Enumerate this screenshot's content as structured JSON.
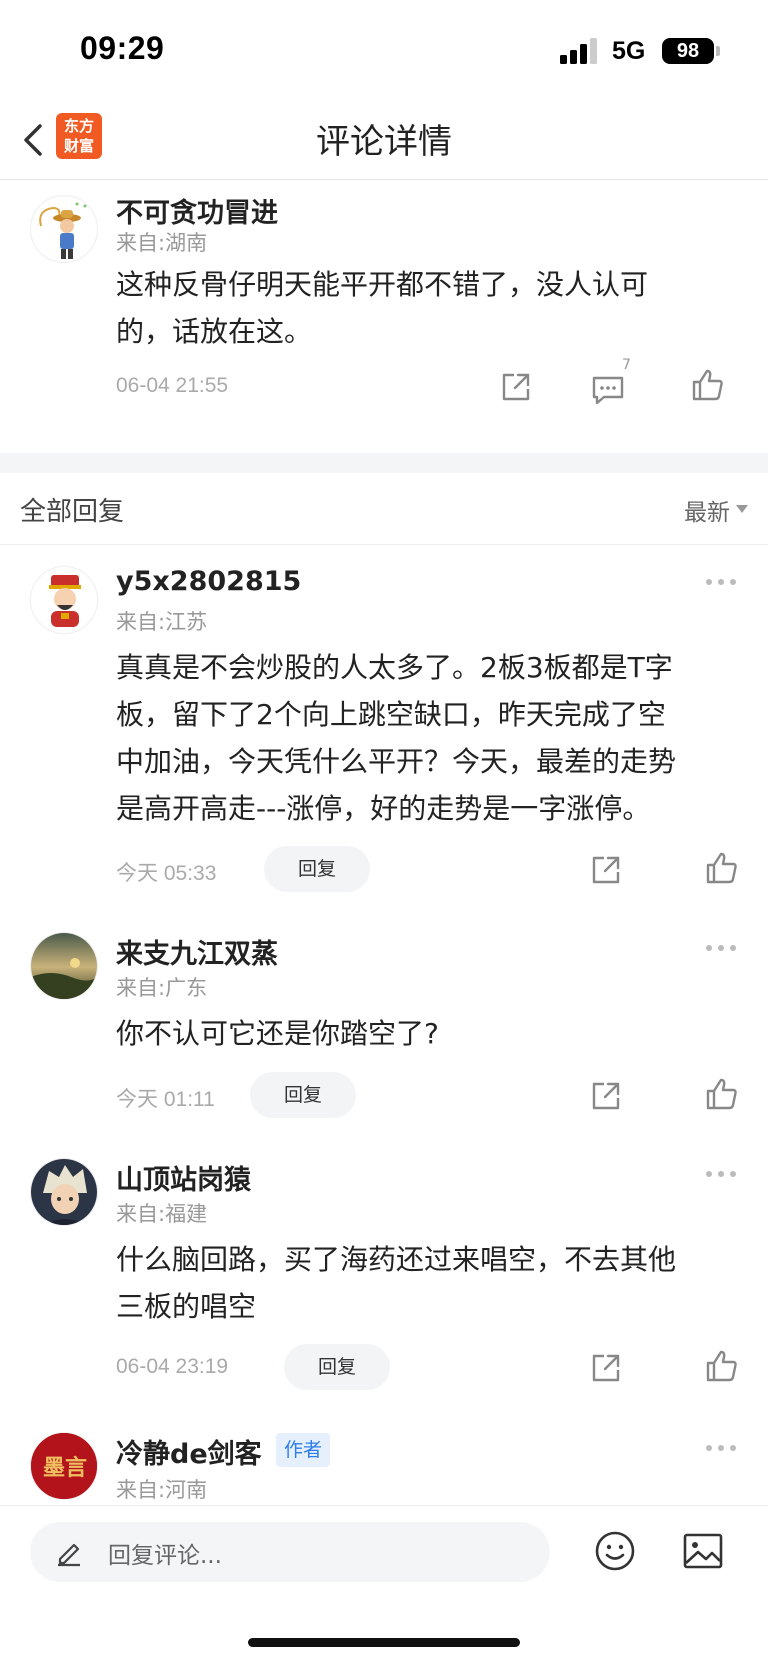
{
  "status": {
    "time": "09:29",
    "network": "5G",
    "battery": "98"
  },
  "header": {
    "logo_line1": "东方",
    "logo_line2": "财富",
    "title": "评论详情"
  },
  "main_comment": {
    "name": "不可贪功冒进",
    "location": "来自:湖南",
    "content_line1": "这种反骨仔明天能平开都不错了，没人认可",
    "content_line2": "的，话放在这。",
    "timestamp": "06-04 21:55",
    "reply_count": "7"
  },
  "replies_header": {
    "label": "全部回复",
    "sort": "最新"
  },
  "replies": [
    {
      "name": "y5x2802815",
      "location": "来自:江苏",
      "lines": [
        "真真是不会炒股的人太多了。2板3板都是T字",
        "板，留下了2个向上跳空缺口，昨天完成了空",
        "中加油，今天凭什么平开？今天，最差的走势",
        "是高开高走---涨停，好的走势是一字涨停。"
      ],
      "timestamp": "今天 05:33",
      "reply_label": "回复"
    },
    {
      "name": "来支九江双蒸",
      "location": "来自:广东",
      "lines": [
        "你不认可它还是你踏空了?"
      ],
      "timestamp": "今天 01:11",
      "reply_label": "回复"
    },
    {
      "name": "山顶站岗猿",
      "location": "来自:福建",
      "lines": [
        "什么脑回路，买了海药还过来唱空，不去其他",
        "三板的唱空"
      ],
      "timestamp": "06-04 23:19",
      "reply_label": "回复"
    },
    {
      "name": "冷静de剑客",
      "badge": "作者",
      "location": "来自:河南",
      "avatar_text": "墨言"
    }
  ],
  "input": {
    "placeholder": "回复评论..."
  },
  "colors": {
    "brand": "#f15a22",
    "badge_blue": "#2b7de9"
  }
}
